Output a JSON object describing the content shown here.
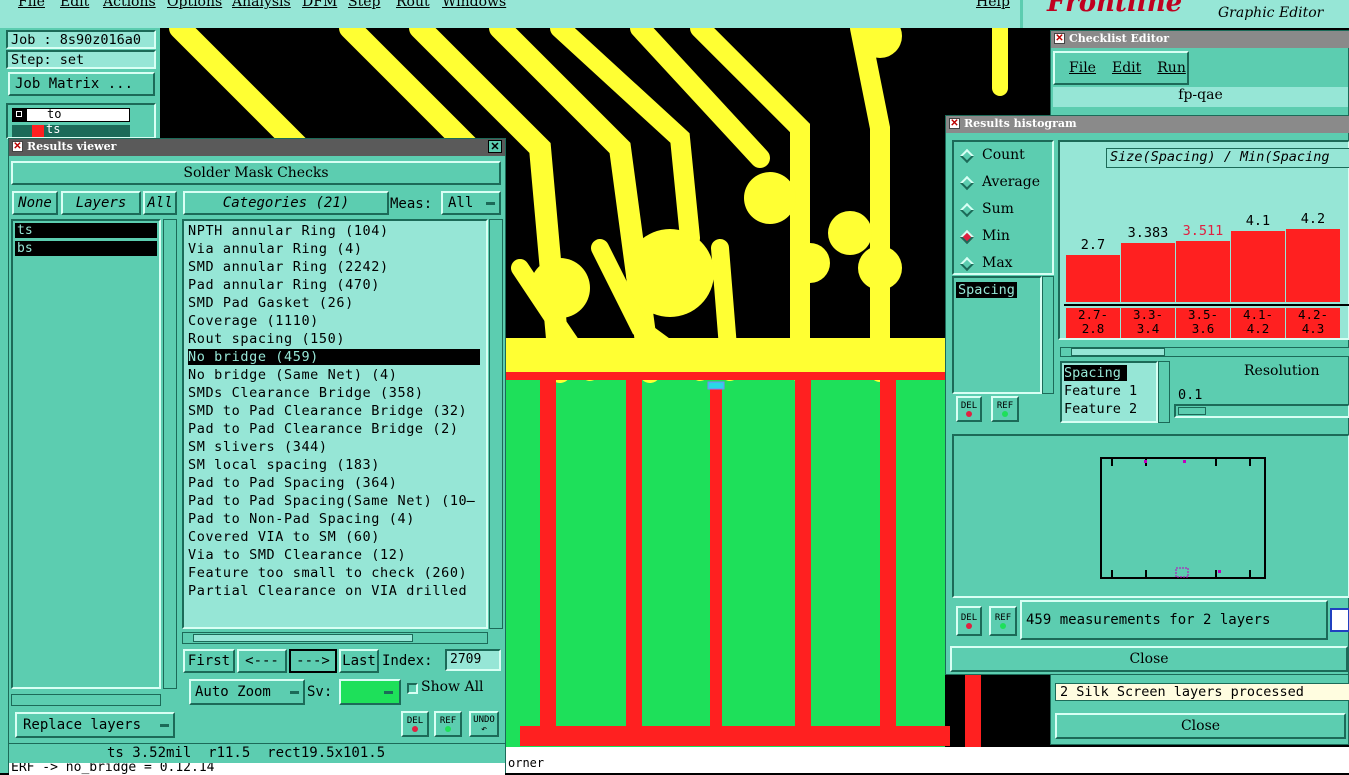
{
  "main_menu": [
    "File",
    "Edit",
    "Actions",
    "Options",
    "Analysis",
    "DFM",
    "Step",
    "Rout",
    "Windows",
    "Help"
  ],
  "brand": {
    "logo": "Frontline",
    "subtitle": "Graphic Editor"
  },
  "job": {
    "label": "Job : 8s90z016a0",
    "step": "Step: set",
    "matrix_button": "Job Matrix ..."
  },
  "layer_toolbar": [
    {
      "name": "to",
      "color": "#000000"
    },
    {
      "name": "ts",
      "color": "#ff2020"
    }
  ],
  "results_viewer": {
    "title": "Results viewer",
    "header": "Solder Mask Checks",
    "none": "None",
    "layers": "Layers",
    "all": "All",
    "categories_button": "Categories (21)",
    "meas_label": "Meas:",
    "meas_value": "All",
    "layer_list": [
      "ts",
      "bs"
    ],
    "categories": [
      "NPTH annular Ring (104)",
      "Via annular Ring (4)",
      "SMD annular Ring (2242)",
      "Pad annular Ring (470)",
      "SMD Pad Gasket (26)",
      "Coverage (1110)",
      "Rout spacing (150)",
      "No bridge (459)",
      "No bridge (Same Net) (4)",
      "SMDs Clearance Bridge (358)",
      "SMD to Pad Clearance Bridge (32)",
      "Pad to Pad Clearance Bridge (2)",
      "SM slivers (344)",
      "SM local spacing (183)",
      "Pad to Pad Spacing (364)",
      "Pad to Pad Spacing(Same Net) (10̶",
      "Pad to Non-Pad Spacing (4)",
      "Covered VIA to SM (60)",
      "Via to SMD Clearance (12)",
      "Feature too small to check (260)",
      "Partial Clearance on VIA drilled"
    ],
    "selected_category": "No bridge (459)",
    "first": "First",
    "prev": "<---",
    "next": "--->",
    "last": "Last",
    "index_label": "Index:",
    "index_value": "2709",
    "zoom": "Auto Zoom",
    "sv_label": "Sv:",
    "show_all": "Show All",
    "replace_layers": "Replace layers",
    "del": "DEL",
    "ref": "REF",
    "undo": "UNDO",
    "status": "ts 3.52mil  r11.5  rect19.5x101.5",
    "console": "ERF -> no_bridge = 0.12.14"
  },
  "checklist_editor": {
    "title": "Checklist Editor",
    "menu": [
      "File",
      "Edit",
      "Run"
    ],
    "name": "fp-qae",
    "status": "2 Silk Screen layers processed",
    "close": "Close"
  },
  "histogram": {
    "title": "Results histogram",
    "modes": [
      "Count",
      "Average",
      "Sum",
      "Min",
      "Max"
    ],
    "selected_mode": "Min",
    "chart_title": "Size(Spacing) / Min(Spacing",
    "attributes": [
      "Spacing"
    ],
    "attr_list": [
      "Spacing",
      "Feature 1",
      "Feature 2"
    ],
    "resolution_label": "Resolution",
    "resolution_value": "0.1",
    "del": "DEL",
    "ref": "REF",
    "summary": "459 measurements for 2 layers",
    "close": "Close"
  },
  "chart_data": {
    "type": "bar",
    "title": "Size(Spacing) / Min(Spacing",
    "categories": [
      "2.7-\n2.8",
      "3.3-\n3.4",
      "3.5-\n3.6",
      "4.1-\n4.2",
      "4.2-\n4.3"
    ],
    "values": [
      2.7,
      3.383,
      3.511,
      4.1,
      4.2
    ],
    "value_labels": [
      "2.7",
      "3.383",
      "3.511",
      "4.1",
      "4.2"
    ],
    "highlight_index": 2,
    "colors": {
      "bar": "#ff2020",
      "highlight_label": "#e02040"
    }
  },
  "bottom_text": "orner"
}
